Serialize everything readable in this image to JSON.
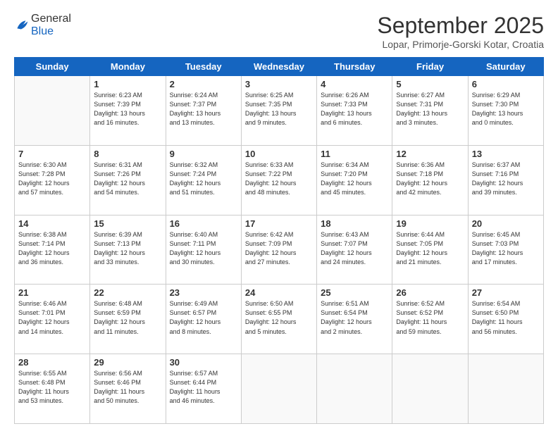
{
  "header": {
    "logo_general": "General",
    "logo_blue": "Blue",
    "month": "September 2025",
    "location": "Lopar, Primorje-Gorski Kotar, Croatia"
  },
  "weekdays": [
    "Sunday",
    "Monday",
    "Tuesday",
    "Wednesday",
    "Thursday",
    "Friday",
    "Saturday"
  ],
  "weeks": [
    [
      {
        "day": "",
        "info": ""
      },
      {
        "day": "1",
        "info": "Sunrise: 6:23 AM\nSunset: 7:39 PM\nDaylight: 13 hours\nand 16 minutes."
      },
      {
        "day": "2",
        "info": "Sunrise: 6:24 AM\nSunset: 7:37 PM\nDaylight: 13 hours\nand 13 minutes."
      },
      {
        "day": "3",
        "info": "Sunrise: 6:25 AM\nSunset: 7:35 PM\nDaylight: 13 hours\nand 9 minutes."
      },
      {
        "day": "4",
        "info": "Sunrise: 6:26 AM\nSunset: 7:33 PM\nDaylight: 13 hours\nand 6 minutes."
      },
      {
        "day": "5",
        "info": "Sunrise: 6:27 AM\nSunset: 7:31 PM\nDaylight: 13 hours\nand 3 minutes."
      },
      {
        "day": "6",
        "info": "Sunrise: 6:29 AM\nSunset: 7:30 PM\nDaylight: 13 hours\nand 0 minutes."
      }
    ],
    [
      {
        "day": "7",
        "info": "Sunrise: 6:30 AM\nSunset: 7:28 PM\nDaylight: 12 hours\nand 57 minutes."
      },
      {
        "day": "8",
        "info": "Sunrise: 6:31 AM\nSunset: 7:26 PM\nDaylight: 12 hours\nand 54 minutes."
      },
      {
        "day": "9",
        "info": "Sunrise: 6:32 AM\nSunset: 7:24 PM\nDaylight: 12 hours\nand 51 minutes."
      },
      {
        "day": "10",
        "info": "Sunrise: 6:33 AM\nSunset: 7:22 PM\nDaylight: 12 hours\nand 48 minutes."
      },
      {
        "day": "11",
        "info": "Sunrise: 6:34 AM\nSunset: 7:20 PM\nDaylight: 12 hours\nand 45 minutes."
      },
      {
        "day": "12",
        "info": "Sunrise: 6:36 AM\nSunset: 7:18 PM\nDaylight: 12 hours\nand 42 minutes."
      },
      {
        "day": "13",
        "info": "Sunrise: 6:37 AM\nSunset: 7:16 PM\nDaylight: 12 hours\nand 39 minutes."
      }
    ],
    [
      {
        "day": "14",
        "info": "Sunrise: 6:38 AM\nSunset: 7:14 PM\nDaylight: 12 hours\nand 36 minutes."
      },
      {
        "day": "15",
        "info": "Sunrise: 6:39 AM\nSunset: 7:13 PM\nDaylight: 12 hours\nand 33 minutes."
      },
      {
        "day": "16",
        "info": "Sunrise: 6:40 AM\nSunset: 7:11 PM\nDaylight: 12 hours\nand 30 minutes."
      },
      {
        "day": "17",
        "info": "Sunrise: 6:42 AM\nSunset: 7:09 PM\nDaylight: 12 hours\nand 27 minutes."
      },
      {
        "day": "18",
        "info": "Sunrise: 6:43 AM\nSunset: 7:07 PM\nDaylight: 12 hours\nand 24 minutes."
      },
      {
        "day": "19",
        "info": "Sunrise: 6:44 AM\nSunset: 7:05 PM\nDaylight: 12 hours\nand 21 minutes."
      },
      {
        "day": "20",
        "info": "Sunrise: 6:45 AM\nSunset: 7:03 PM\nDaylight: 12 hours\nand 17 minutes."
      }
    ],
    [
      {
        "day": "21",
        "info": "Sunrise: 6:46 AM\nSunset: 7:01 PM\nDaylight: 12 hours\nand 14 minutes."
      },
      {
        "day": "22",
        "info": "Sunrise: 6:48 AM\nSunset: 6:59 PM\nDaylight: 12 hours\nand 11 minutes."
      },
      {
        "day": "23",
        "info": "Sunrise: 6:49 AM\nSunset: 6:57 PM\nDaylight: 12 hours\nand 8 minutes."
      },
      {
        "day": "24",
        "info": "Sunrise: 6:50 AM\nSunset: 6:55 PM\nDaylight: 12 hours\nand 5 minutes."
      },
      {
        "day": "25",
        "info": "Sunrise: 6:51 AM\nSunset: 6:54 PM\nDaylight: 12 hours\nand 2 minutes."
      },
      {
        "day": "26",
        "info": "Sunrise: 6:52 AM\nSunset: 6:52 PM\nDaylight: 11 hours\nand 59 minutes."
      },
      {
        "day": "27",
        "info": "Sunrise: 6:54 AM\nSunset: 6:50 PM\nDaylight: 11 hours\nand 56 minutes."
      }
    ],
    [
      {
        "day": "28",
        "info": "Sunrise: 6:55 AM\nSunset: 6:48 PM\nDaylight: 11 hours\nand 53 minutes."
      },
      {
        "day": "29",
        "info": "Sunrise: 6:56 AM\nSunset: 6:46 PM\nDaylight: 11 hours\nand 50 minutes."
      },
      {
        "day": "30",
        "info": "Sunrise: 6:57 AM\nSunset: 6:44 PM\nDaylight: 11 hours\nand 46 minutes."
      },
      {
        "day": "",
        "info": ""
      },
      {
        "day": "",
        "info": ""
      },
      {
        "day": "",
        "info": ""
      },
      {
        "day": "",
        "info": ""
      }
    ]
  ]
}
